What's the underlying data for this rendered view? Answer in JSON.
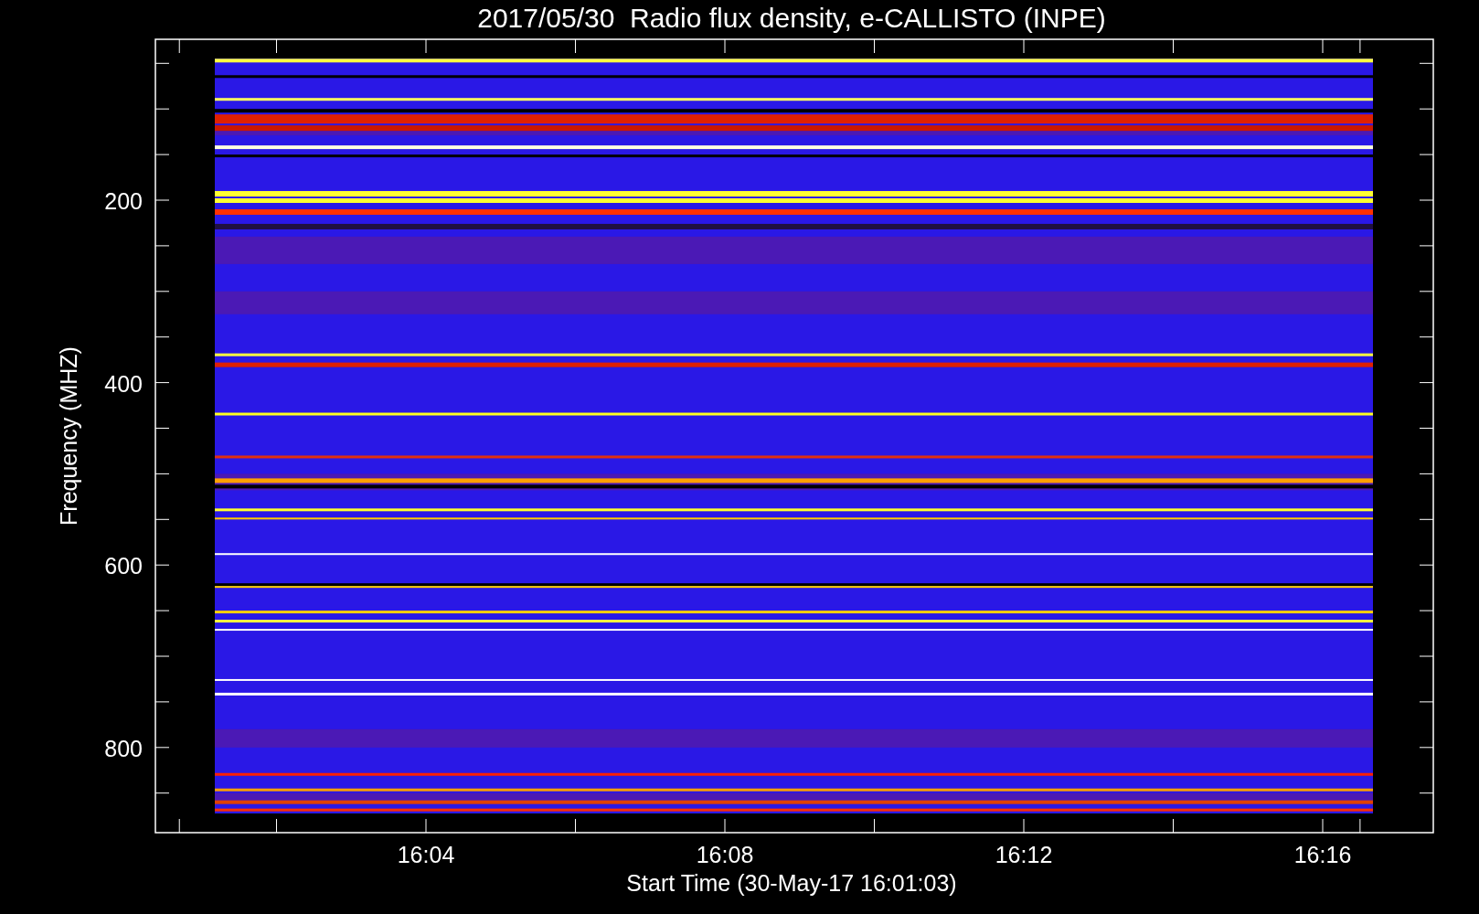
{
  "title": "2017/05/30  Radio flux density, e-CALLISTO (INPE)",
  "y_axis": {
    "label": "Frequency (MHZ)",
    "ticks": [
      "200",
      "400",
      "600",
      "800"
    ]
  },
  "x_axis": {
    "label": "Start Time (30-May-17 16:01:03)",
    "ticks": [
      "16:04",
      "16:08",
      "16:12",
      "16:16"
    ]
  }
}
